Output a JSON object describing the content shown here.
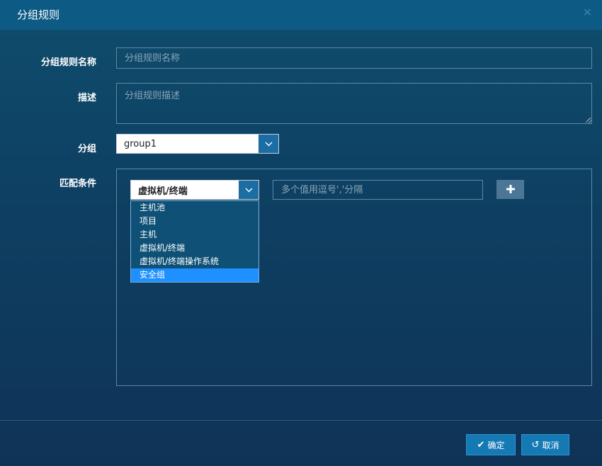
{
  "dialog": {
    "title": "分组规则",
    "close_icon": "close-icon"
  },
  "form": {
    "name_label": "分组规则名称",
    "name_placeholder": "分组规则名称",
    "name_value": "",
    "desc_label": "描述",
    "desc_placeholder": "分组规则描述",
    "desc_value": "",
    "group_label": "分组",
    "group_selected": "group1",
    "match_label": "匹配条件"
  },
  "condition": {
    "type_selected": "虚拟机/终端",
    "value_placeholder": "多个值用逗号','分隔",
    "add_icon": "plus-icon",
    "options": [
      {
        "label": "主机池",
        "active": false
      },
      {
        "label": "项目",
        "active": false
      },
      {
        "label": "主机",
        "active": false
      },
      {
        "label": "虚拟机/终端",
        "active": false
      },
      {
        "label": "虚拟机/终端操作系统",
        "active": false
      },
      {
        "label": "安全组",
        "active": true
      }
    ]
  },
  "footer": {
    "confirm_label": "确定",
    "confirm_icon": "check-icon",
    "cancel_label": "取消",
    "cancel_icon": "undo-icon"
  },
  "colors": {
    "header_bg": "#0d5a85",
    "accent": "#1579b4",
    "active_option": "#1e90ff"
  }
}
